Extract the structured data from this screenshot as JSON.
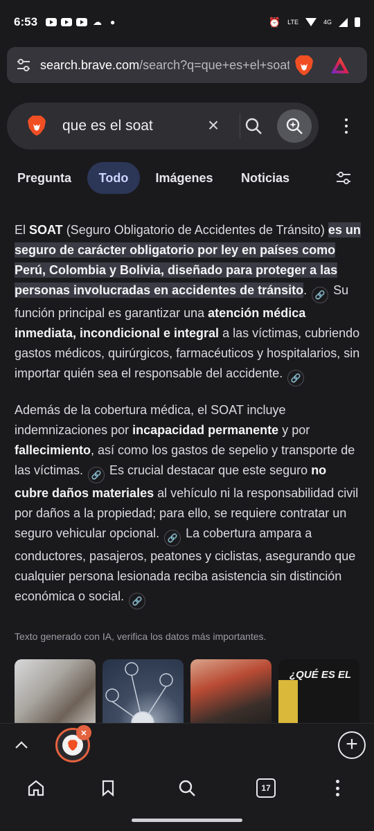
{
  "status_bar": {
    "time": "6:53",
    "network": "4G"
  },
  "address_bar": {
    "url_host": "search.brave.com",
    "url_rest": "/search?q=que+es+el+soat"
  },
  "search": {
    "query": "que es el soat",
    "placeholder": ""
  },
  "tabs": [
    {
      "label": "Pregunta"
    },
    {
      "label": "Todo"
    },
    {
      "label": "Imágenes"
    },
    {
      "label": "Noticias"
    }
  ],
  "answer": {
    "p1": {
      "a": "El ",
      "b": "SOAT",
      "c": " (Seguro Obligatorio de Accidentes de Tránsito) ",
      "hl": "es un seguro de carácter obligatorio por ley en países como Perú, Colombia y Bolivia, diseñado para proteger a las personas involucradas en accidentes de tránsito",
      "d": ". ",
      "e": " Su función principal es garantizar una ",
      "f": "atención médica inmediata, incondicional e integral",
      "g": " a las víctimas, cubriendo gastos médicos, quirúrgicos, farmacéuticos y hospitalarios, sin importar quién sea el responsable del accidente. "
    },
    "p2": {
      "a": "Además de la cobertura médica, el SOAT incluye indemnizaciones por ",
      "b": "incapacidad permanente",
      "c": " y por ",
      "d": "fallecimiento",
      "e": ", así como los gastos de sepelio y transporte de las víctimas. ",
      "f": " Es crucial destacar que este seguro ",
      "g": "no cubre daños materiales",
      "h": " al vehículo ni la responsabilidad civil por daños a la propiedad; para ello, se requiere contratar un seguro vehicular opcional. ",
      "i": " La cobertura ampara a conductores, pasajeros, peatones y ciclistas, asegurando que cualquier persona lesionada reciba asistencia sin distinción económica o social. "
    },
    "ai_note": "Texto generado con IA, verifica los datos más importantes."
  },
  "images": {
    "thumb4_text": "¿QUÉ ES EL"
  },
  "bottom": {
    "tab_count": "17"
  },
  "colors": {
    "accent_orange": "#e3623f",
    "tab_active_bg": "#2c3657",
    "highlight_bg": "#3b3b45"
  },
  "icons": [
    "tune-icon",
    "brave-lion-icon",
    "brave-rewards-icon",
    "close-icon",
    "search-icon",
    "ai-search-icon",
    "more-vert-icon",
    "filter-icon",
    "link-icon",
    "chevron-up-icon",
    "plus-icon",
    "home-icon",
    "bookmark-icon",
    "search-icon",
    "tab-count-icon"
  ]
}
